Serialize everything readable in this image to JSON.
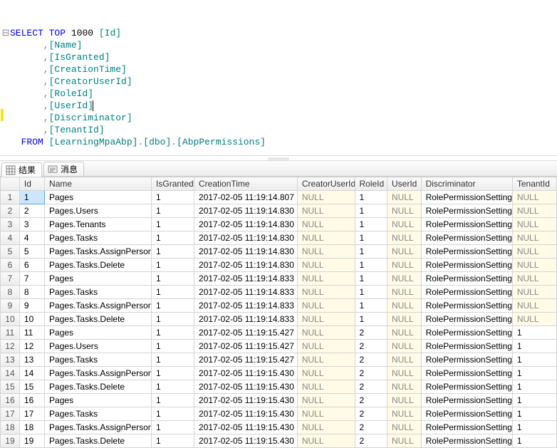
{
  "query": {
    "lines": [
      {
        "gutter": "⊟",
        "segs": [
          [
            "kw",
            "SELECT"
          ],
          [
            "p",
            " "
          ],
          [
            "kw",
            "TOP"
          ],
          [
            "p",
            " "
          ],
          [
            "num",
            "1000"
          ],
          [
            "p",
            " "
          ],
          [
            "br",
            "[Id]"
          ]
        ]
      },
      {
        "gutter": "",
        "segs": [
          [
            "p",
            "      ,"
          ],
          [
            "br",
            "[Name]"
          ]
        ]
      },
      {
        "gutter": "",
        "segs": [
          [
            "p",
            "      ,"
          ],
          [
            "br",
            "[IsGranted]"
          ]
        ]
      },
      {
        "gutter": "",
        "segs": [
          [
            "p",
            "      ,"
          ],
          [
            "br",
            "[CreationTime]"
          ]
        ]
      },
      {
        "gutter": "",
        "segs": [
          [
            "p",
            "      ,"
          ],
          [
            "br",
            "[CreatorUserId]"
          ]
        ]
      },
      {
        "gutter": "",
        "segs": [
          [
            "p",
            "      ,"
          ],
          [
            "br",
            "[RoleId]"
          ]
        ]
      },
      {
        "gutter": "",
        "segs": [
          [
            "p",
            "      ,"
          ],
          [
            "br",
            "[UserId]"
          ],
          [
            "caret",
            ""
          ]
        ]
      },
      {
        "gutter": "",
        "segs": [
          [
            "p",
            "      ,"
          ],
          [
            "br",
            "[Discriminator]"
          ]
        ]
      },
      {
        "gutter": "",
        "segs": [
          [
            "p",
            "      ,"
          ],
          [
            "br",
            "[TenantId]"
          ]
        ]
      },
      {
        "gutter": "",
        "segs": [
          [
            "p",
            "  "
          ],
          [
            "kw",
            "FROM"
          ],
          [
            "p",
            " "
          ],
          [
            "br",
            "[LearningMpaAbp]"
          ],
          [
            "p",
            "."
          ],
          [
            "br",
            "[dbo]"
          ],
          [
            "p",
            "."
          ],
          [
            "br",
            "[AbpPermissions]"
          ]
        ]
      }
    ]
  },
  "tabs": {
    "results": "结果",
    "messages": "消息"
  },
  "grid": {
    "headers": [
      "Id",
      "Name",
      "IsGranted",
      "CreationTime",
      "CreatorUserId",
      "RoleId",
      "UserId",
      "Discriminator",
      "TenantId"
    ],
    "null_label": "NULL",
    "rows": [
      {
        "n": 1,
        "Id": "1",
        "Name": "Pages",
        "IsGranted": "1",
        "CreationTime": "2017-02-05 11:19:14.807",
        "CreatorUserId": null,
        "RoleId": "1",
        "UserId": null,
        "Discriminator": "RolePermissionSetting",
        "TenantId": null
      },
      {
        "n": 2,
        "Id": "2",
        "Name": "Pages.Users",
        "IsGranted": "1",
        "CreationTime": "2017-02-05 11:19:14.830",
        "CreatorUserId": null,
        "RoleId": "1",
        "UserId": null,
        "Discriminator": "RolePermissionSetting",
        "TenantId": null
      },
      {
        "n": 3,
        "Id": "3",
        "Name": "Pages.Tenants",
        "IsGranted": "1",
        "CreationTime": "2017-02-05 11:19:14.830",
        "CreatorUserId": null,
        "RoleId": "1",
        "UserId": null,
        "Discriminator": "RolePermissionSetting",
        "TenantId": null
      },
      {
        "n": 4,
        "Id": "4",
        "Name": "Pages.Tasks",
        "IsGranted": "1",
        "CreationTime": "2017-02-05 11:19:14.830",
        "CreatorUserId": null,
        "RoleId": "1",
        "UserId": null,
        "Discriminator": "RolePermissionSetting",
        "TenantId": null
      },
      {
        "n": 5,
        "Id": "5",
        "Name": "Pages.Tasks.AssignPerson",
        "IsGranted": "1",
        "CreationTime": "2017-02-05 11:19:14.830",
        "CreatorUserId": null,
        "RoleId": "1",
        "UserId": null,
        "Discriminator": "RolePermissionSetting",
        "TenantId": null
      },
      {
        "n": 6,
        "Id": "6",
        "Name": "Pages.Tasks.Delete",
        "IsGranted": "1",
        "CreationTime": "2017-02-05 11:19:14.830",
        "CreatorUserId": null,
        "RoleId": "1",
        "UserId": null,
        "Discriminator": "RolePermissionSetting",
        "TenantId": null
      },
      {
        "n": 7,
        "Id": "7",
        "Name": "Pages",
        "IsGranted": "1",
        "CreationTime": "2017-02-05 11:19:14.833",
        "CreatorUserId": null,
        "RoleId": "1",
        "UserId": null,
        "Discriminator": "RolePermissionSetting",
        "TenantId": null
      },
      {
        "n": 8,
        "Id": "8",
        "Name": "Pages.Tasks",
        "IsGranted": "1",
        "CreationTime": "2017-02-05 11:19:14.833",
        "CreatorUserId": null,
        "RoleId": "1",
        "UserId": null,
        "Discriminator": "RolePermissionSetting",
        "TenantId": null
      },
      {
        "n": 9,
        "Id": "9",
        "Name": "Pages.Tasks.AssignPerson",
        "IsGranted": "1",
        "CreationTime": "2017-02-05 11:19:14.833",
        "CreatorUserId": null,
        "RoleId": "1",
        "UserId": null,
        "Discriminator": "RolePermissionSetting",
        "TenantId": null
      },
      {
        "n": 10,
        "Id": "10",
        "Name": "Pages.Tasks.Delete",
        "IsGranted": "1",
        "CreationTime": "2017-02-05 11:19:14.833",
        "CreatorUserId": null,
        "RoleId": "1",
        "UserId": null,
        "Discriminator": "RolePermissionSetting",
        "TenantId": null
      },
      {
        "n": 11,
        "Id": "11",
        "Name": "Pages",
        "IsGranted": "1",
        "CreationTime": "2017-02-05 11:19:15.427",
        "CreatorUserId": null,
        "RoleId": "2",
        "UserId": null,
        "Discriminator": "RolePermissionSetting",
        "TenantId": "1"
      },
      {
        "n": 12,
        "Id": "12",
        "Name": "Pages.Users",
        "IsGranted": "1",
        "CreationTime": "2017-02-05 11:19:15.427",
        "CreatorUserId": null,
        "RoleId": "2",
        "UserId": null,
        "Discriminator": "RolePermissionSetting",
        "TenantId": "1"
      },
      {
        "n": 13,
        "Id": "13",
        "Name": "Pages.Tasks",
        "IsGranted": "1",
        "CreationTime": "2017-02-05 11:19:15.427",
        "CreatorUserId": null,
        "RoleId": "2",
        "UserId": null,
        "Discriminator": "RolePermissionSetting",
        "TenantId": "1"
      },
      {
        "n": 14,
        "Id": "14",
        "Name": "Pages.Tasks.AssignPerson",
        "IsGranted": "1",
        "CreationTime": "2017-02-05 11:19:15.430",
        "CreatorUserId": null,
        "RoleId": "2",
        "UserId": null,
        "Discriminator": "RolePermissionSetting",
        "TenantId": "1"
      },
      {
        "n": 15,
        "Id": "15",
        "Name": "Pages.Tasks.Delete",
        "IsGranted": "1",
        "CreationTime": "2017-02-05 11:19:15.430",
        "CreatorUserId": null,
        "RoleId": "2",
        "UserId": null,
        "Discriminator": "RolePermissionSetting",
        "TenantId": "1"
      },
      {
        "n": 16,
        "Id": "16",
        "Name": "Pages",
        "IsGranted": "1",
        "CreationTime": "2017-02-05 11:19:15.430",
        "CreatorUserId": null,
        "RoleId": "2",
        "UserId": null,
        "Discriminator": "RolePermissionSetting",
        "TenantId": "1"
      },
      {
        "n": 17,
        "Id": "17",
        "Name": "Pages.Tasks",
        "IsGranted": "1",
        "CreationTime": "2017-02-05 11:19:15.430",
        "CreatorUserId": null,
        "RoleId": "2",
        "UserId": null,
        "Discriminator": "RolePermissionSetting",
        "TenantId": "1"
      },
      {
        "n": 18,
        "Id": "18",
        "Name": "Pages.Tasks.AssignPerson",
        "IsGranted": "1",
        "CreationTime": "2017-02-05 11:19:15.430",
        "CreatorUserId": null,
        "RoleId": "2",
        "UserId": null,
        "Discriminator": "RolePermissionSetting",
        "TenantId": "1"
      },
      {
        "n": 19,
        "Id": "19",
        "Name": "Pages.Tasks.Delete",
        "IsGranted": "1",
        "CreationTime": "2017-02-05 11:19:15.430",
        "CreatorUserId": null,
        "RoleId": "2",
        "UserId": null,
        "Discriminator": "RolePermissionSetting",
        "TenantId": "1"
      }
    ]
  }
}
